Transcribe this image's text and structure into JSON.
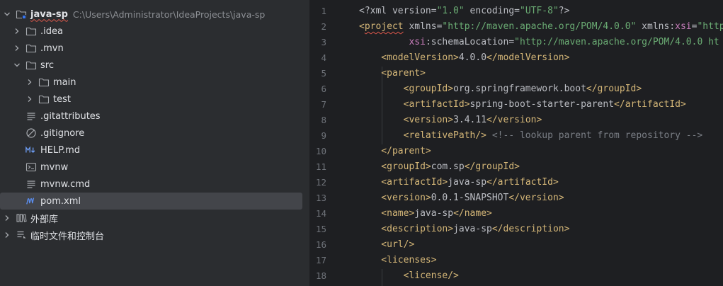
{
  "project_tree": {
    "root": {
      "name": "java-sp",
      "path": "C:\\Users\\Administrator\\IdeaProjects\\java-sp"
    },
    "items": [
      {
        "label": ".idea"
      },
      {
        "label": ".mvn"
      },
      {
        "label": "src"
      },
      {
        "label": "main"
      },
      {
        "label": "test"
      },
      {
        "label": ".gitattributes"
      },
      {
        "label": ".gitignore"
      },
      {
        "label": "HELP.md"
      },
      {
        "label": "mvnw"
      },
      {
        "label": "mvnw.cmd"
      },
      {
        "label": "pom.xml"
      }
    ],
    "external_libraries": "外部库",
    "scratches": "临时文件和控制台"
  },
  "editor": {
    "line_numbers": [
      "1",
      "2",
      "3",
      "4",
      "5",
      "6",
      "7",
      "8",
      "9",
      "10",
      "11",
      "12",
      "13",
      "14",
      "15",
      "16",
      "17",
      "18"
    ],
    "lines": [
      [
        [
          "punct",
          "<?xml version="
        ],
        [
          "val",
          "\"1.0\""
        ],
        [
          "punct",
          " encoding="
        ],
        [
          "val",
          "\"UTF-8\""
        ],
        [
          "punct",
          "?>"
        ]
      ],
      [
        [
          "tag",
          "<"
        ],
        [
          "tagw",
          "project"
        ],
        [
          "attr",
          " xmlns="
        ],
        [
          "val",
          "\"http://maven.apache.org/POM/4.0.0\""
        ],
        [
          "attr",
          " xmlns:"
        ],
        [
          "ns",
          "xsi"
        ],
        [
          "attr",
          "="
        ],
        [
          "val",
          "\"http"
        ]
      ],
      [
        [
          "attr",
          "         "
        ],
        [
          "ns",
          "xsi"
        ],
        [
          "attr",
          ":schemaLocation="
        ],
        [
          "val",
          "\"http://maven.apache.org/POM/4.0.0 ht"
        ]
      ],
      [
        [
          "tag",
          "    <modelVersion>"
        ],
        [
          "text",
          "4.0.0"
        ],
        [
          "tag",
          "</modelVersion>"
        ]
      ],
      [
        [
          "tag",
          "    <parent>"
        ]
      ],
      [
        [
          "tag",
          "        <groupId>"
        ],
        [
          "text",
          "org.springframework.boot"
        ],
        [
          "tag",
          "</groupId>"
        ]
      ],
      [
        [
          "tag",
          "        <artifactId>"
        ],
        [
          "text",
          "spring-boot-starter-parent"
        ],
        [
          "tag",
          "</artifactId>"
        ]
      ],
      [
        [
          "tag",
          "        <version>"
        ],
        [
          "text",
          "3.4.11"
        ],
        [
          "tag",
          "</version>"
        ]
      ],
      [
        [
          "tag",
          "        <relativePath/>"
        ],
        [
          "comment",
          " <!-- lookup parent from repository -->"
        ]
      ],
      [
        [
          "tag",
          "    </parent>"
        ]
      ],
      [
        [
          "tag",
          "    <groupId>"
        ],
        [
          "text",
          "com.sp"
        ],
        [
          "tag",
          "</groupId>"
        ]
      ],
      [
        [
          "tag",
          "    <artifactId>"
        ],
        [
          "text",
          "java-sp"
        ],
        [
          "tag",
          "</artifactId>"
        ]
      ],
      [
        [
          "tag",
          "    <version>"
        ],
        [
          "text",
          "0.0.1-SNAPSHOT"
        ],
        [
          "tag",
          "</version>"
        ]
      ],
      [
        [
          "tag",
          "    <name>"
        ],
        [
          "text",
          "java-sp"
        ],
        [
          "tag",
          "</name>"
        ]
      ],
      [
        [
          "tag",
          "    <description>"
        ],
        [
          "text",
          "java-sp"
        ],
        [
          "tag",
          "</description>"
        ]
      ],
      [
        [
          "tag",
          "    <url/>"
        ]
      ],
      [
        [
          "tag",
          "    <licenses>"
        ]
      ],
      [
        [
          "tag",
          "        <license/>"
        ]
      ]
    ]
  },
  "colors": {
    "tree_bg": "#2b2d30",
    "editor_bg": "#1e1f22",
    "tag": "#d5b778",
    "string": "#6aab73",
    "namespace": "#c77dbb",
    "comment": "#7a7e85",
    "selection": "#43454a",
    "maven_icon": "#5b8ef0"
  }
}
